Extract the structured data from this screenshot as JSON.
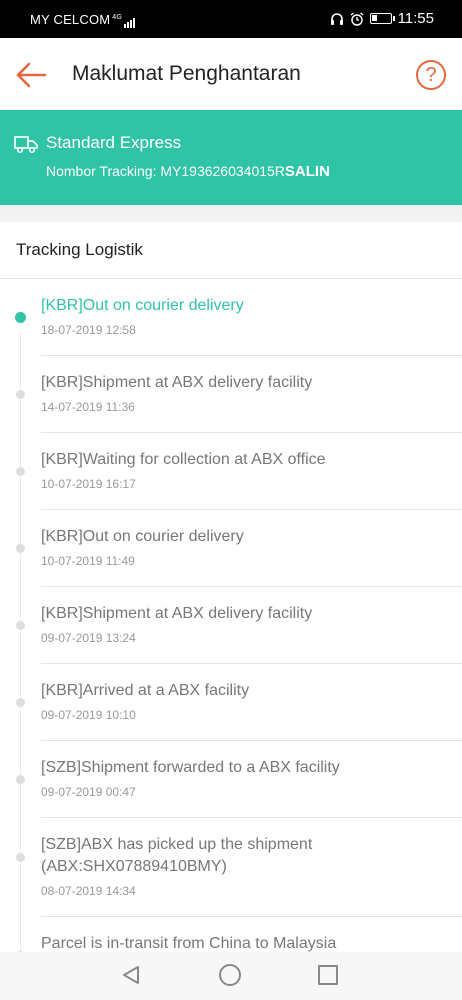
{
  "status_bar": {
    "carrier": "MY CELCOM",
    "network": "4G",
    "time": "11:55"
  },
  "header": {
    "title": "Maklumat Penghantaran",
    "back_icon": "arrow-left-icon",
    "help_icon": "help-circle-icon",
    "help_glyph": "?"
  },
  "shipping": {
    "method": "Standard Express",
    "tracking_label": "Nombor Tracking: ",
    "tracking_number": "MY193626034015R",
    "copy_label": "SALIN",
    "icon": "truck-icon"
  },
  "tracking": {
    "section_title": "Tracking Logistik",
    "events": [
      {
        "text": "[KBR]Out on courier delivery",
        "time": "18-07-2019 12:58"
      },
      {
        "text": "[KBR]Shipment at ABX delivery facility",
        "time": "14-07-2019 11:36"
      },
      {
        "text": "[KBR]Waiting for collection at ABX office",
        "time": "10-07-2019 16:17"
      },
      {
        "text": "[KBR]Out on courier delivery",
        "time": "10-07-2019 11:49"
      },
      {
        "text": "[KBR]Shipment at ABX delivery facility",
        "time": "09-07-2019 13:24"
      },
      {
        "text": "[KBR]Arrived at a ABX facility",
        "time": "09-07-2019 10:10"
      },
      {
        "text": "[SZB]Shipment forwarded to a ABX facility",
        "time": "09-07-2019 00:47"
      },
      {
        "text": "[SZB]ABX has picked up the shipment (ABX:SHX07889410BMY)",
        "time": "08-07-2019 14:34"
      },
      {
        "text": "Parcel is in-transit from China to Malaysia",
        "time": ""
      }
    ]
  },
  "colors": {
    "accent": "#e8663b",
    "teal": "#2fc4a6"
  }
}
